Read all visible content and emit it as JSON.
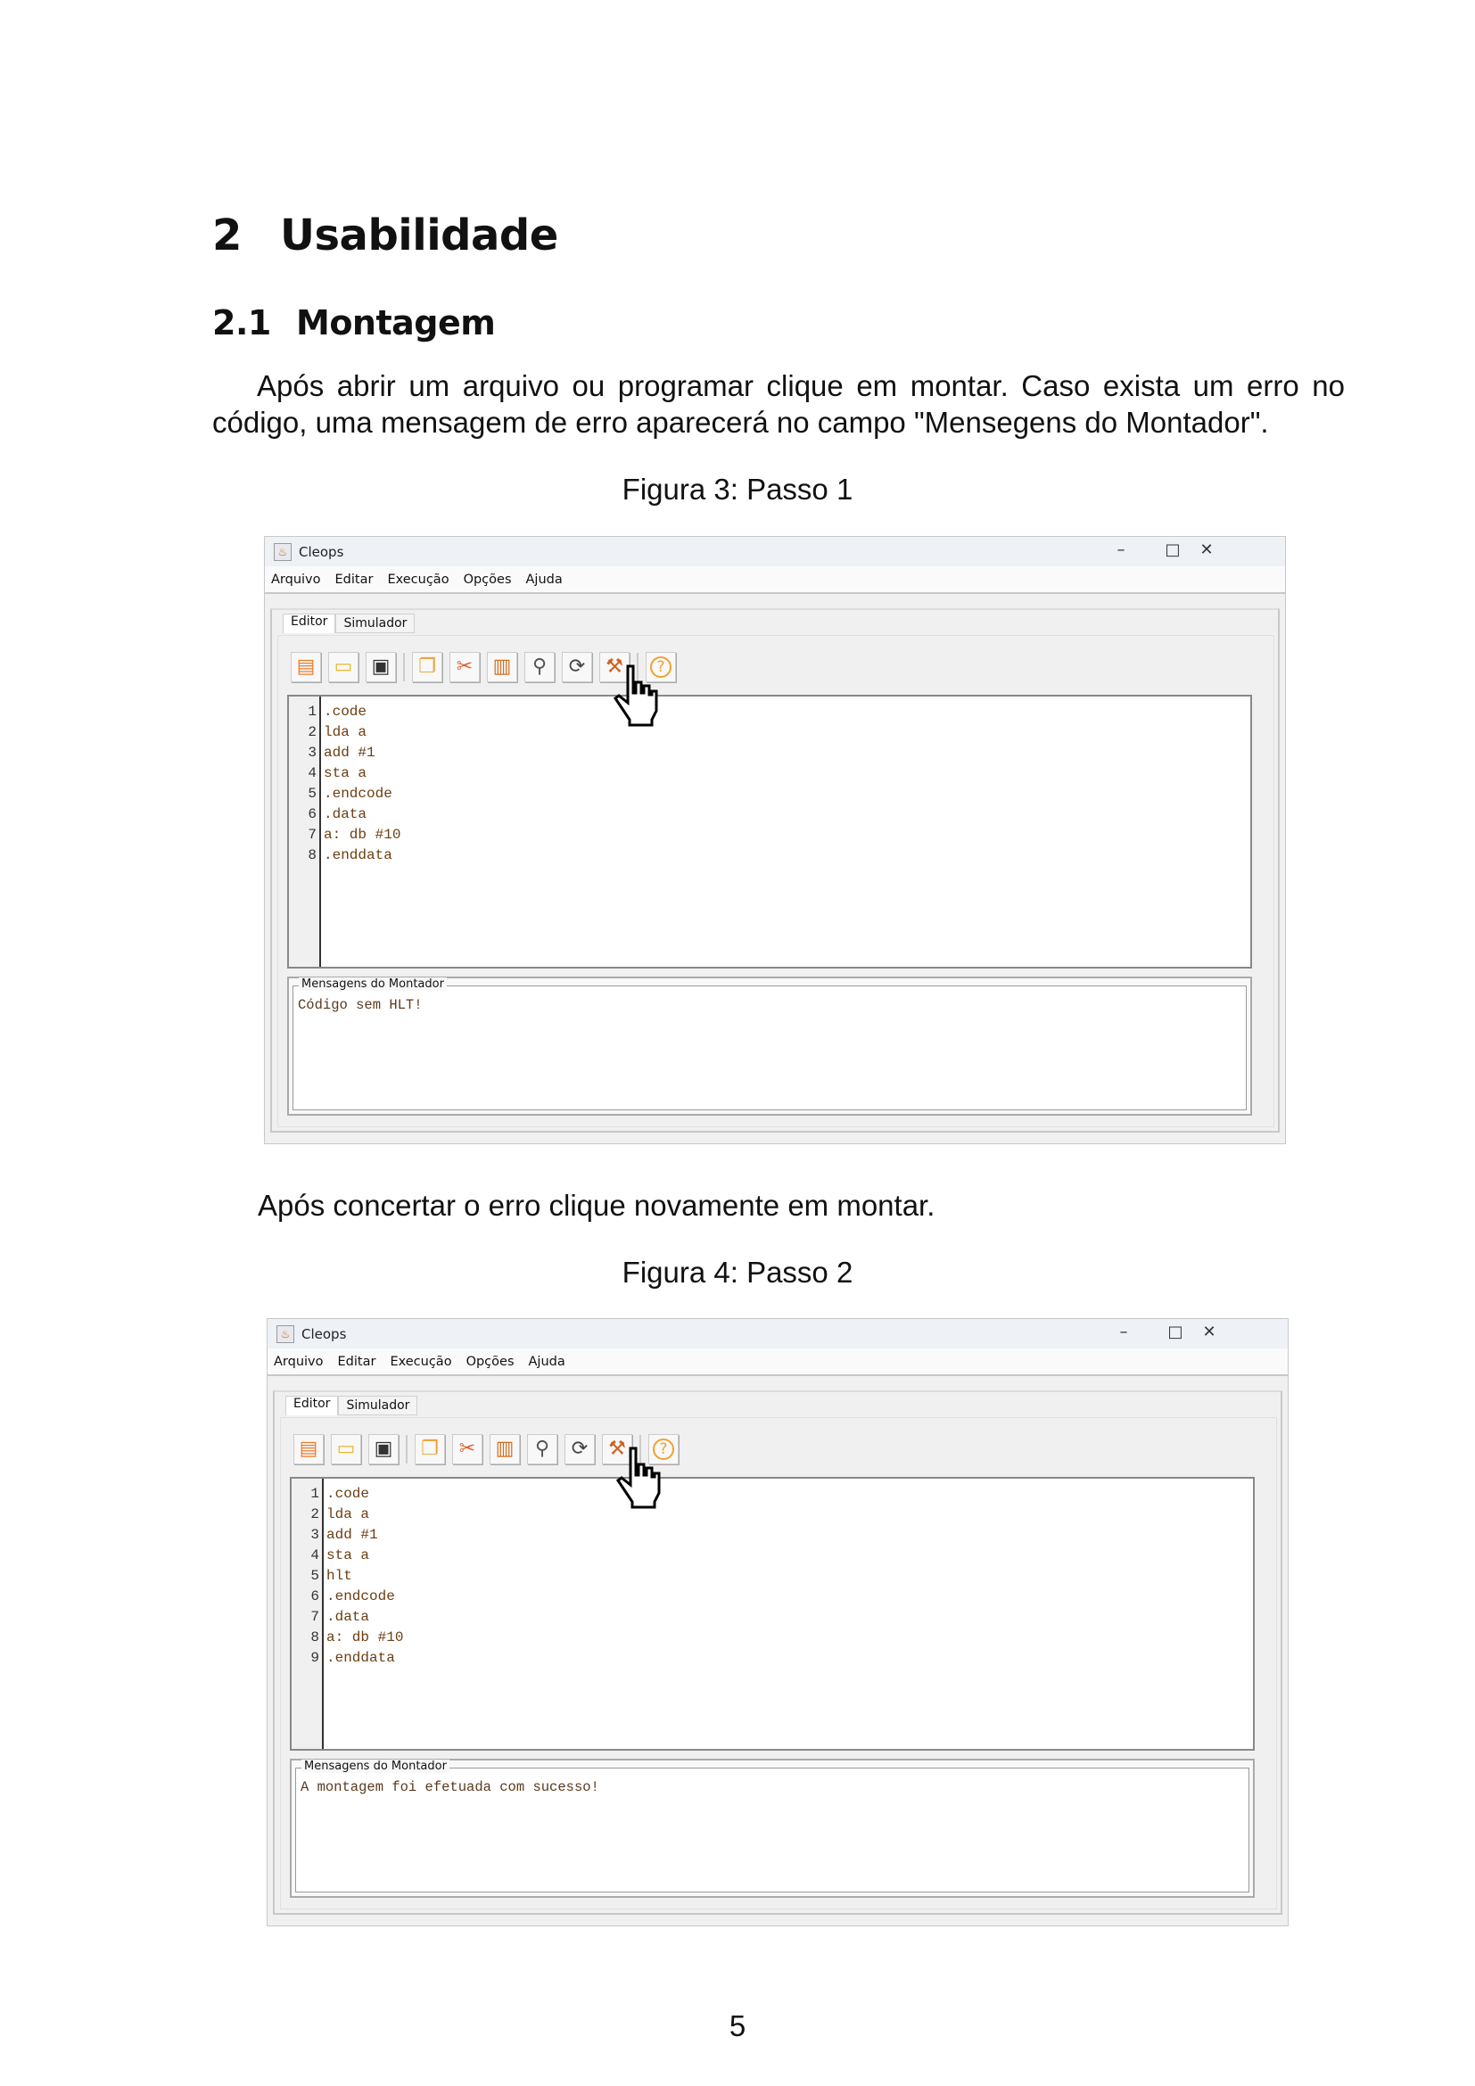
{
  "section": {
    "number": "2",
    "title": "Usabilidade"
  },
  "subsection": {
    "number": "2.1",
    "title": "Montagem"
  },
  "paragraph1": "Após abrir um arquivo ou programar clique em montar.  Caso exista um erro no código, uma mensagem de erro aparecerá no campo \"Mensegens do Montador\".",
  "paragraph2": "Após concertar o erro clique novamente em montar.",
  "page_number": "5",
  "figures": [
    {
      "caption": "Figura 3: Passo 1",
      "window_title": "Cleops",
      "menu": [
        "Arquivo",
        "Editar",
        "Execução",
        "Opções",
        "Ajuda"
      ],
      "tabs": [
        "Editor",
        "Simulador"
      ],
      "code": [
        ".code",
        "lda a",
        "add #1",
        "sta a",
        ".endcode",
        ".data",
        "a: db #10",
        ".enddata"
      ],
      "messages_label": "Mensagens do Montador",
      "message": "Código sem HLT!"
    },
    {
      "caption": "Figura 4: Passo 2",
      "window_title": "Cleops",
      "menu": [
        "Arquivo",
        "Editar",
        "Execução",
        "Opções",
        "Ajuda"
      ],
      "tabs": [
        "Editor",
        "Simulador"
      ],
      "code": [
        ".code",
        "lda a",
        "add #1",
        "sta a",
        "hlt",
        ".endcode",
        ".data",
        "a: db #10",
        ".enddata"
      ],
      "messages_label": "Mensagens do Montador",
      "message": "A montagem foi efetuada com sucesso!"
    }
  ],
  "toolbar_icons": [
    "new-file-icon",
    "open-folder-icon",
    "save-icon",
    "|",
    "copy-icon",
    "cut-icon",
    "paste-icon",
    "search-icon",
    "refresh-icon",
    "assemble-tools-icon",
    "|",
    "help-icon"
  ],
  "window_controls": [
    "minimize-icon",
    "maximize-icon",
    "close-icon"
  ]
}
